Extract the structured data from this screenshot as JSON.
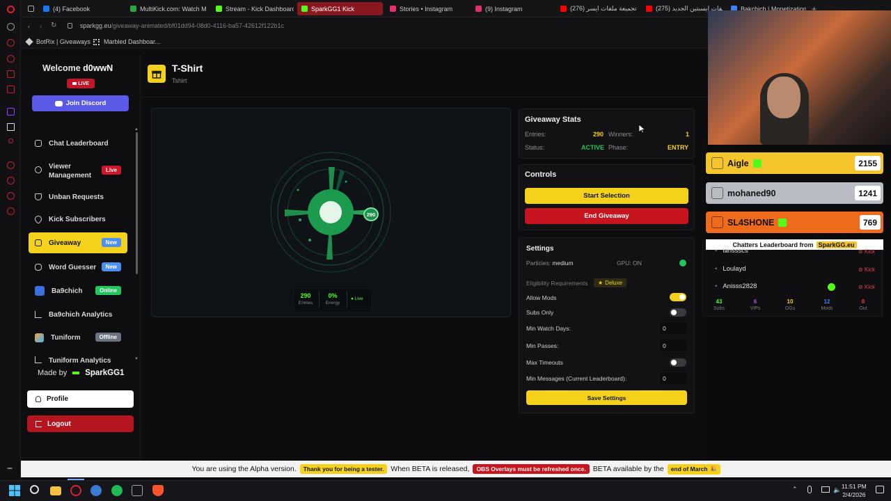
{
  "browser": {
    "tabs": [
      {
        "label": "(4) Facebook",
        "color": "#1877f2"
      },
      {
        "label": "MultiKick.com: Watch M",
        "color": "#28a745"
      },
      {
        "label": "Stream - Kick Dashboard",
        "color": "#53fc18"
      },
      {
        "label": "SparkGG1 Kick",
        "color": "#53fc18"
      },
      {
        "label": "Stories • Instagram",
        "color": "#e1306c"
      },
      {
        "label": "(9) Instagram",
        "color": "#e1306c"
      },
      {
        "label": "تجميعة ملفات ايسر (276)",
        "color": "#ff0000"
      },
      {
        "label": "ملفات ايسبتين الجديد (275)",
        "color": "#ff0000"
      },
      {
        "label": "Bakchich | Monetization",
        "color": "#3b82f6"
      }
    ],
    "url_host": "sparkgg.eu",
    "url_path": "/giveaway-animated/bf01dd94-08d0-4116-ba57-42612f122b1c",
    "bookmarks": [
      "BotRix | Giveaways",
      "Marbled Dashboar..."
    ]
  },
  "sidebar": {
    "welcome_prefix": "Welcome",
    "username": "d0wwN",
    "live_label": "LIVE",
    "discord_label": "Join Discord",
    "items": [
      {
        "label": "Chat Leaderboard",
        "badge": ""
      },
      {
        "label": "Viewer",
        "label2": "Management",
        "badge": "Live"
      },
      {
        "label": "Unban Requests",
        "badge": ""
      },
      {
        "label": "Kick Subscribers",
        "badge": ""
      },
      {
        "label": "Giveaway",
        "badge": "New"
      },
      {
        "label": "Word Guesser",
        "badge": "New"
      },
      {
        "label": "Ba9chich",
        "badge": "Online"
      },
      {
        "label": "Ba9chich Analytics",
        "badge": ""
      },
      {
        "label": "Tuniform",
        "badge": "Offline"
      },
      {
        "label": "Tuniform Analytics",
        "badge": ""
      }
    ],
    "made_by": "Made by",
    "made_by_name": "SparkGG1",
    "profile_label": "Profile",
    "logout_label": "Logout"
  },
  "header": {
    "title": "T-Shirt",
    "subtitle": "Tshirt"
  },
  "radar": {
    "entries_value": "290",
    "entries_label": "Entries",
    "energy_value": "0%",
    "energy_label": "Energy",
    "live_label": "Live",
    "center_badge": "290"
  },
  "stats": {
    "title": "Giveaway Stats",
    "entries_label": "Entries:",
    "entries_value": "290",
    "winners_label": "Winners:",
    "winners_value": "1",
    "status_label": "Status:",
    "status_value": "ACTIVE",
    "phase_label": "Phase:",
    "phase_value": "ENTRY"
  },
  "controls": {
    "title": "Controls",
    "start_label": "Start Selection",
    "end_label": "End Giveaway"
  },
  "settings": {
    "title": "Settings",
    "particles_label": "Particles:",
    "particles_value": "medium",
    "gpu_label": "GPU: ON",
    "eligibility_label": "Eligibility Requirements",
    "deluxe_label": "Deluxe",
    "allow_mods": "Allow Mods",
    "subs_only": "Subs Only",
    "min_watch_days": "Min Watch Days:",
    "min_watch_days_value": "0",
    "min_passes": "Min Passes:",
    "min_passes_value": "0",
    "max_timeouts": "Max Timeouts",
    "min_messages": "Min Messages (Current Leaderboard):",
    "min_messages_value": "0",
    "save_label": "Save Settings"
  },
  "overlay": {
    "leaders": [
      {
        "name": "Aigle",
        "score": "2155",
        "color": "#f4c52c"
      },
      {
        "name": "mohaned90",
        "score": "1241",
        "color": "#b9bcc2"
      },
      {
        "name": "SL4SHONE",
        "score": "769",
        "color": "#ee6a1c"
      }
    ],
    "chatters_text": "Chatters Leaderboard from",
    "chatters_site": "SparkGG.eu",
    "chat_rows": [
      {
        "name": "larissscs",
        "kick": "Kick"
      },
      {
        "name": "Loulayd",
        "kick": "Kick"
      },
      {
        "name": "Anisss2828",
        "kick": "Kick"
      }
    ],
    "mini_stats": [
      {
        "value": "43",
        "label": "Subs",
        "color": "#53fc18"
      },
      {
        "value": "6",
        "label": "VIPs",
        "color": "#a855f7"
      },
      {
        "value": "10",
        "label": "OGs",
        "color": "#f4d21c"
      },
      {
        "value": "12",
        "label": "Mods",
        "color": "#3b82f6"
      },
      {
        "value": "0",
        "label": "Out",
        "color": "#ef4444"
      }
    ]
  },
  "alpha_bar": {
    "t1": "You are using the Alpha version.",
    "c1": "Thank you for being a tester.",
    "t2": "When BETA is released,",
    "c2": "OBS Overlays must be refreshed once.",
    "t3": "BETA available by the",
    "c3": "end of March 🎉"
  },
  "taskbar": {
    "time": "11:51 PM",
    "date": "2/4/2026"
  }
}
